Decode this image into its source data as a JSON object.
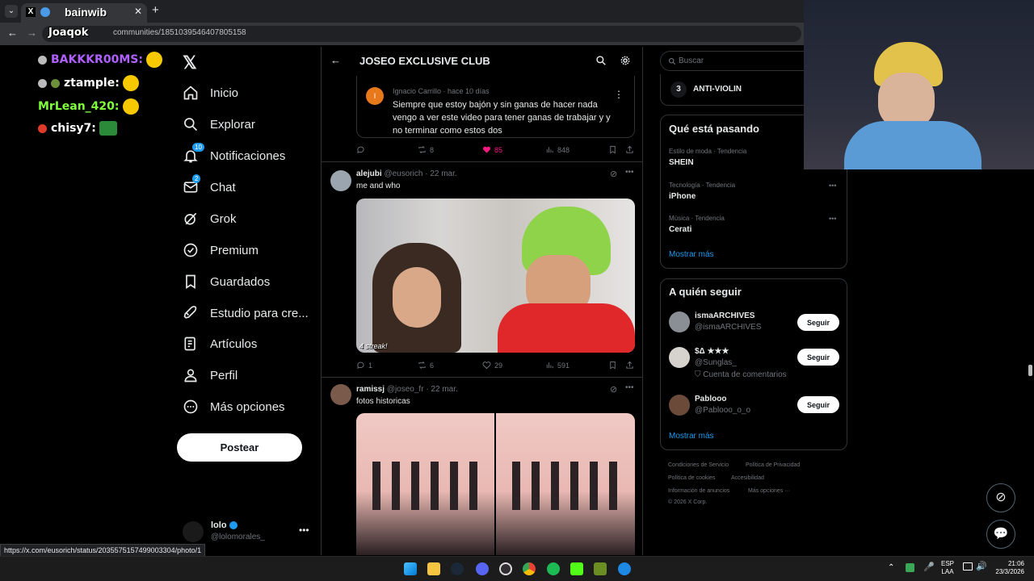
{
  "browser": {
    "tab_title": "bainwib",
    "url": "communities/1851039546407805158",
    "status_url": "https://x.com/eusorich/status/2035575157499003304/photo/1"
  },
  "stream_chat": [
    {
      "user": "Joaqok",
      "color": "#ffffff"
    },
    {
      "user": "BAKKKR00MS",
      "color": "#b060ff"
    },
    {
      "user": "ztample",
      "color": "#ffffff"
    },
    {
      "user": "MrLean_420",
      "color": "#7fff3a"
    },
    {
      "user": "chisy7",
      "color": "#ffffff"
    }
  ],
  "nav": {
    "items": [
      {
        "label": "Inicio",
        "icon": "home-icon"
      },
      {
        "label": "Explorar",
        "icon": "search-icon"
      },
      {
        "label": "Notificaciones",
        "icon": "bell-icon",
        "badge": "10"
      },
      {
        "label": "Chat",
        "icon": "mail-icon",
        "badge": "2"
      },
      {
        "label": "Grok",
        "icon": "grok-icon"
      },
      {
        "label": "Premium",
        "icon": "verified-icon"
      },
      {
        "label": "Guardados",
        "icon": "bookmark-icon"
      },
      {
        "label": "Estudio para cre...",
        "icon": "rocket-icon"
      },
      {
        "label": "Artículos",
        "icon": "article-icon"
      },
      {
        "label": "Perfil",
        "icon": "person-icon"
      },
      {
        "label": "Más opciones",
        "icon": "more-circle-icon"
      }
    ],
    "post_label": "Postear",
    "account": {
      "name": "lolo",
      "handle": "@lolomorales_"
    }
  },
  "community": {
    "title": "JOSEO EXCLUSIVE CLUB"
  },
  "tweets": [
    {
      "comment_author": "Ignacio Carrillo",
      "comment_time": "hace 10 días",
      "comment_text": "Siempre que estoy bajón  y sin ganas de hacer nada vengo a ver este video para tener ganas de trabajar y y no terminar como estos dos",
      "retweets": "8",
      "likes": "85",
      "views": "848"
    },
    {
      "author": "alejubi",
      "handle": "@eusorich",
      "date": "22 mar.",
      "text": "me and who",
      "media_caption": "4 streak!",
      "replies": "1",
      "retweets": "6",
      "likes": "29",
      "views": "591"
    },
    {
      "author": "ramissj",
      "handle": "@joseo_fr",
      "date": "22 mar.",
      "text": "fotos historicas"
    }
  ],
  "right": {
    "search_placeholder": "Buscar",
    "top_item": {
      "rank": "3",
      "name": "ANTI-VIOLIN"
    },
    "trends_title": "Qué está pasando",
    "trends": [
      {
        "meta": "Estilo de moda · Tendencia",
        "name": "SHEIN"
      },
      {
        "meta": "Tecnología · Tendencia",
        "name": "iPhone"
      },
      {
        "meta": "Música · Tendencia",
        "name": "Cerati"
      }
    ],
    "trends_more": "Mostrar más",
    "follow_title": "A quién seguir",
    "follow": [
      {
        "name": "ismaARCHIVES",
        "handle": "@ismaARCHIVES",
        "sub": ""
      },
      {
        "name": "$Δ ★★★",
        "handle": "@Sunglas_",
        "sub": "Cuenta de comentarios"
      },
      {
        "name": "Pablooo",
        "handle": "@Pablooo_o_o",
        "sub": ""
      }
    ],
    "follow_btn": "Seguir",
    "follow_more": "Mostrar más",
    "footer": [
      "Condiciones de Servicio",
      "Política de Privacidad",
      "Política de cookies",
      "Accesibilidad",
      "Información de anuncios",
      "Más opciones ···",
      "© 2026 X Corp."
    ]
  },
  "taskbar": {
    "lang1": "ESP",
    "lang2": "LAA",
    "time": "21:06",
    "date": "23/3/2026"
  },
  "colors": {
    "accent": "#1d9bf0",
    "like": "#f91880"
  }
}
